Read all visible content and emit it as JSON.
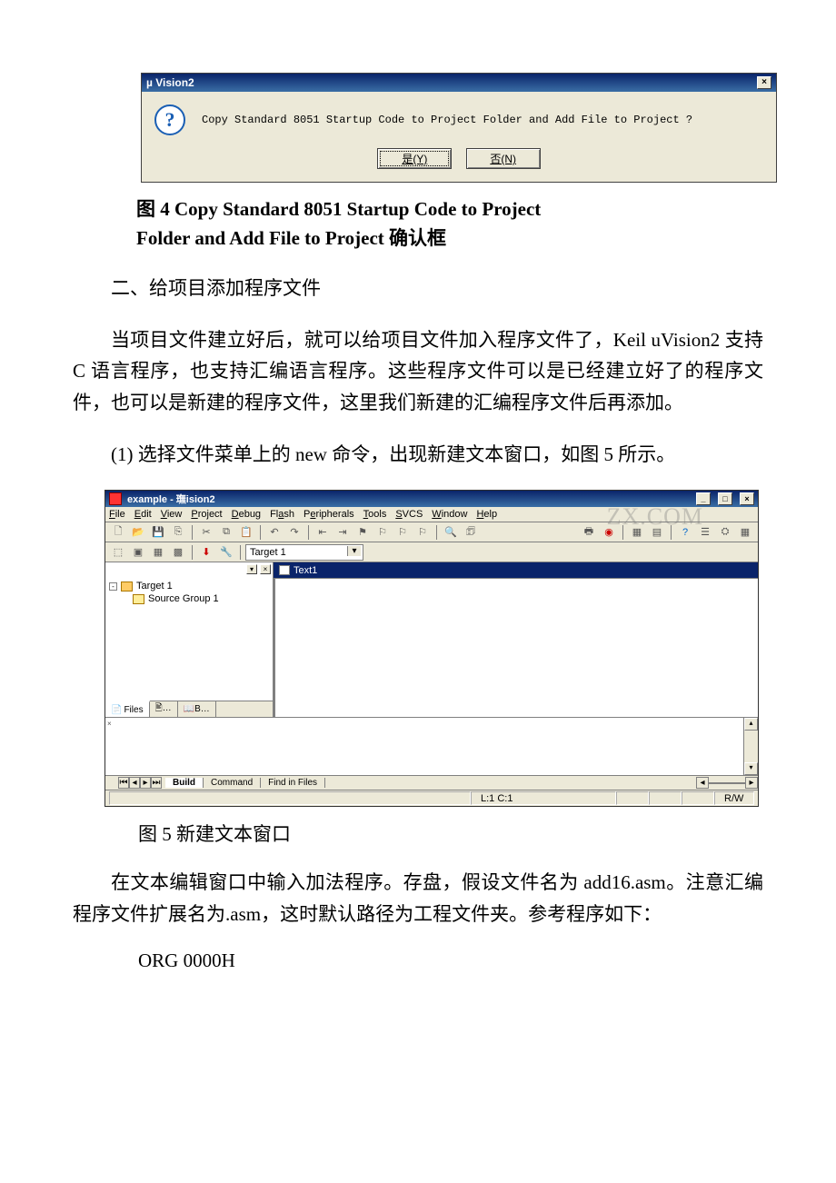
{
  "dialog": {
    "title": "µ Vision2",
    "icon_text": "?",
    "message": "Copy Standard 8051 Startup Code to Project Folder and Add File to Project ?",
    "yes": "是(Y)",
    "no": "否(N)"
  },
  "fig4_caption_line1": "图 4  Copy Standard 8051 Startup Code to Project",
  "fig4_caption_line2": "Folder and Add File to Project 确认框",
  "section2_heading": "二、给项目添加程序文件",
  "para1": "当项目文件建立好后，就可以给项目文件加入程序文件了，Keil uVision2 支持 C 语言程序，也支持汇编语言程序。这些程序文件可以是已经建立好了的程序文件，也可以是新建的程序文件，这里我们新建的汇编程序文件后再添加。",
  "para2": "(1) 选择文件菜单上的 new 命令，出现新建文本窗口，如图 5 所示。",
  "ide": {
    "title_app": "example",
    "title_suffix": " - 璑ision2",
    "menus": [
      "File",
      "Edit",
      "View",
      "Project",
      "Debug",
      "Flash",
      "Peripherals",
      "Tools",
      "SVCS",
      "Window",
      "Help"
    ],
    "target_select": "Target 1",
    "tree_root": "Target 1",
    "tree_child": "Source Group 1",
    "side_tabs": [
      "Files",
      "🖹…",
      "📖B…"
    ],
    "editor_tab": "Text1",
    "out_tabs": [
      "Build",
      "Command",
      "Find in Files"
    ],
    "status_pos": "L:1 C:1",
    "status_mode": "R/W",
    "watermark": "ZX.COM"
  },
  "fig5_caption": "图 5 新建文本窗口",
  "para3": "在文本编辑窗口中输入加法程序。存盘，假设文件名为 add16.asm。注意汇编程序文件扩展名为.asm，这时默认路径为工程文件夹。参考程序如下：",
  "code1": "ORG 0000H"
}
